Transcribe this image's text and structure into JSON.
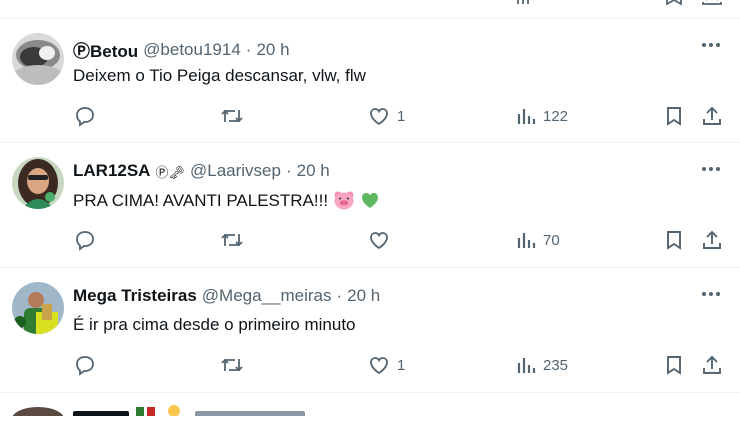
{
  "tweets": [
    {
      "name": "ⓅBetou",
      "badge": "",
      "handle": "@betou1914",
      "dot": "·",
      "time": "20 h",
      "text": "Deixem o Tio Peiga descansar, vlw, flw",
      "likes": "1",
      "views": "122"
    },
    {
      "name": "LAR12SA",
      "badge": "Ⓟ🗝",
      "handle": "@Laarivsep",
      "dot": "·",
      "time": "20 h",
      "text": "PRA CIMA! AVANTI PALESTRA!!! ",
      "emojis": [
        "pig-face",
        "green-heart"
      ],
      "likes": "",
      "views": "70"
    },
    {
      "name": "Mega Tristeiras",
      "badge": "",
      "handle": "@Mega__meiras",
      "dot": "·",
      "time": "20 h",
      "text": "É ir pra cima desde o primeiro minuto",
      "likes": "1",
      "views": "235"
    }
  ],
  "icons": [
    "more-icon",
    "reply-icon",
    "retweet-icon",
    "like-icon",
    "views-icon",
    "bookmark-icon",
    "share-icon"
  ],
  "colors": {
    "muted": "#536471",
    "text": "#0f1419",
    "divider": "#eff3f4"
  }
}
